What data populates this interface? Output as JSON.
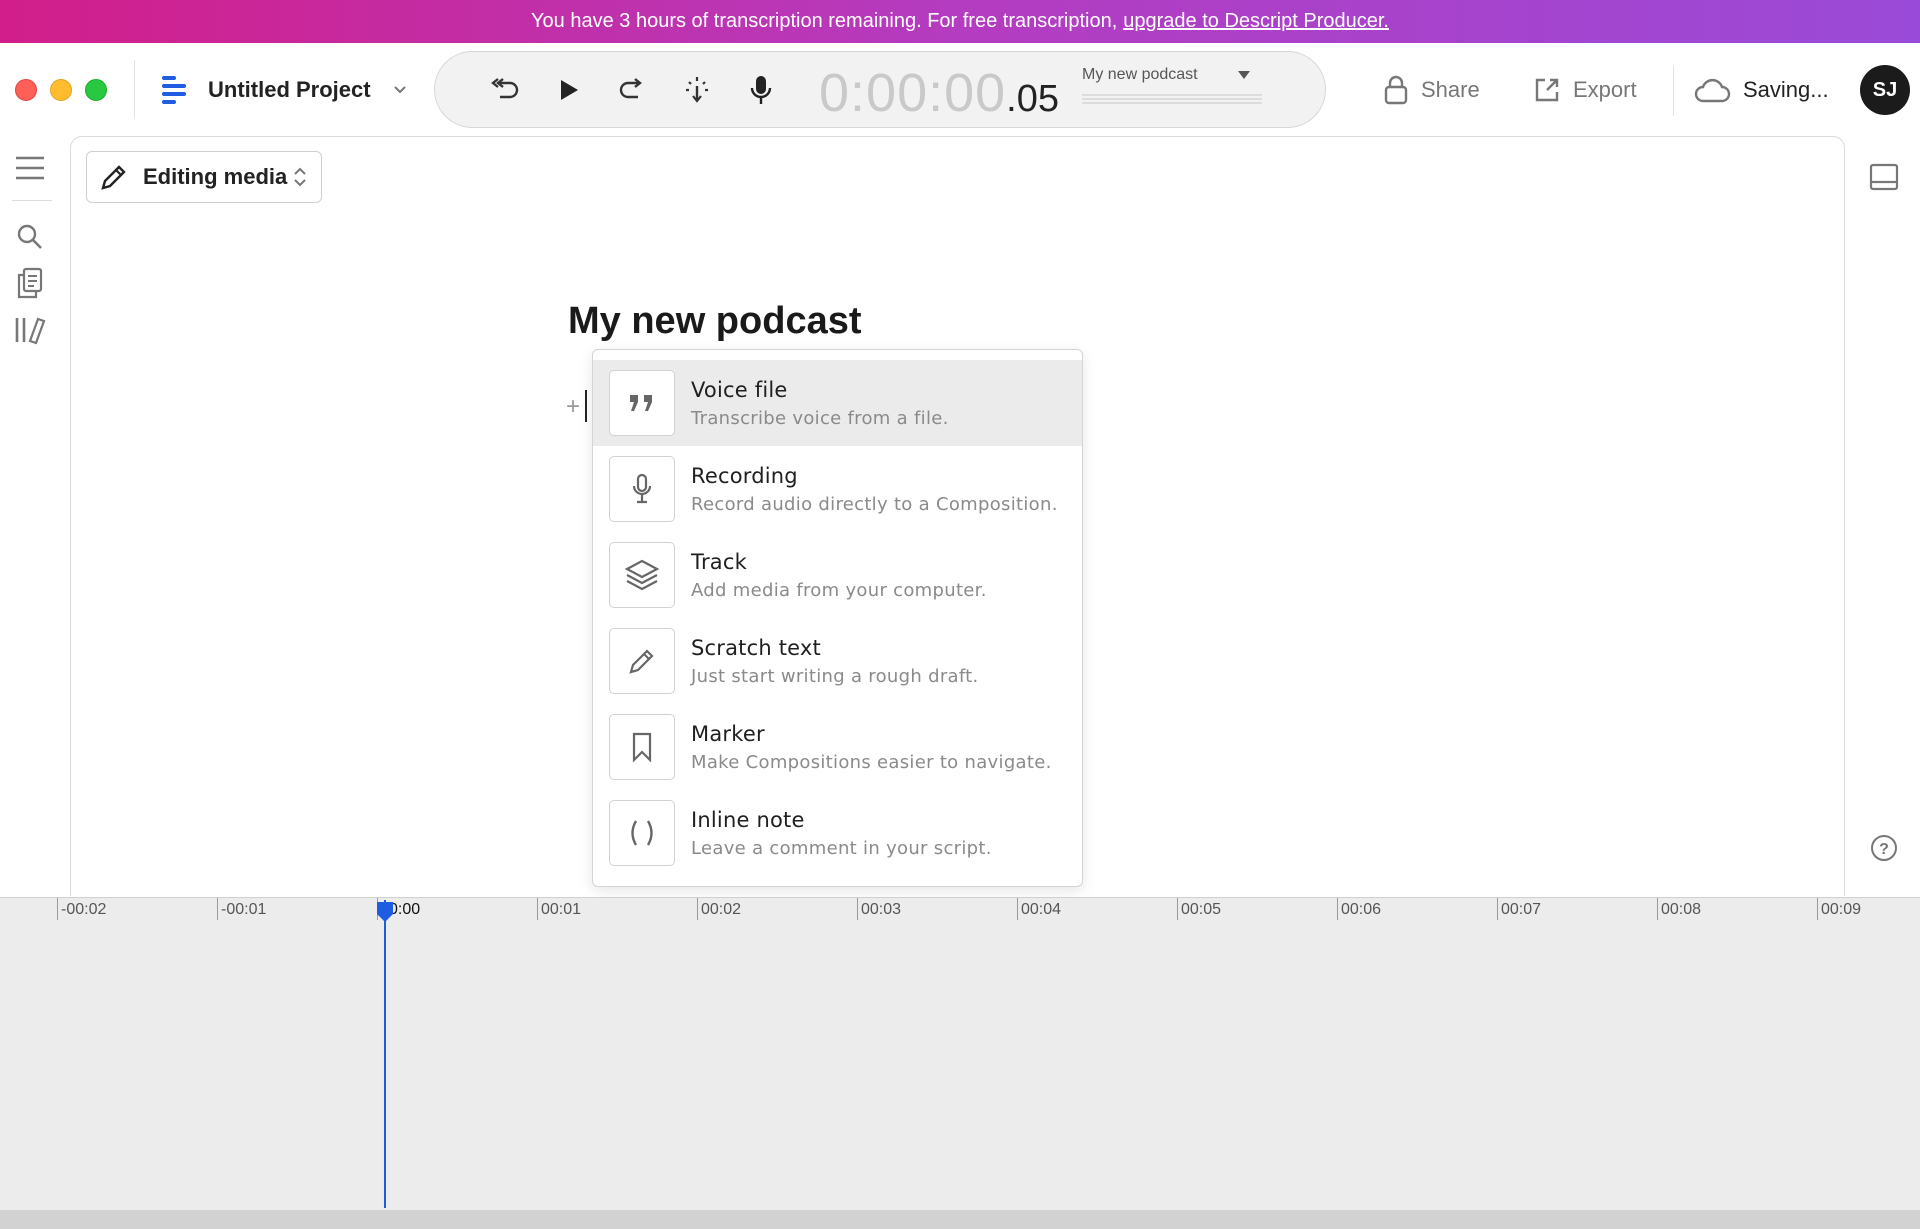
{
  "banner": {
    "message": "You have 3 hours of transcription remaining. For free transcription,",
    "link": "upgrade to Descript Producer."
  },
  "toolbar": {
    "project_name": "Untitled Project",
    "timecode_main": "0:00:00",
    "timecode_frac": ".05",
    "composition": "My new podcast",
    "share_label": "Share",
    "export_label": "Export",
    "status_label": "Saving...",
    "avatar_initials": "SJ"
  },
  "editor": {
    "mode_label": "Editing media",
    "doc_title": "My new podcast",
    "plus": "+"
  },
  "insert_menu": {
    "items": [
      {
        "icon": "quote-icon",
        "title": "Voice file",
        "subtitle": "Transcribe voice from a file."
      },
      {
        "icon": "microphone-icon",
        "title": "Recording",
        "subtitle": "Record audio directly to a Composition."
      },
      {
        "icon": "layers-icon",
        "title": "Track",
        "subtitle": "Add media from your computer."
      },
      {
        "icon": "pencil-icon",
        "title": "Scratch text",
        "subtitle": "Just start writing a rough draft."
      },
      {
        "icon": "bookmark-icon",
        "title": "Marker",
        "subtitle": "Make Compositions easier to navigate."
      },
      {
        "icon": "parentheses-icon",
        "title": "Inline note",
        "subtitle": "Leave a comment in your script."
      }
    ],
    "highlighted_index": 0
  },
  "timeline": {
    "ticks": [
      "-00:02",
      "-00:01",
      "0:00",
      "00:01",
      "00:02",
      "00:03",
      "00:04",
      "00:05",
      "00:06",
      "00:07",
      "00:08",
      "00:09"
    ],
    "playhead": "0:00"
  }
}
